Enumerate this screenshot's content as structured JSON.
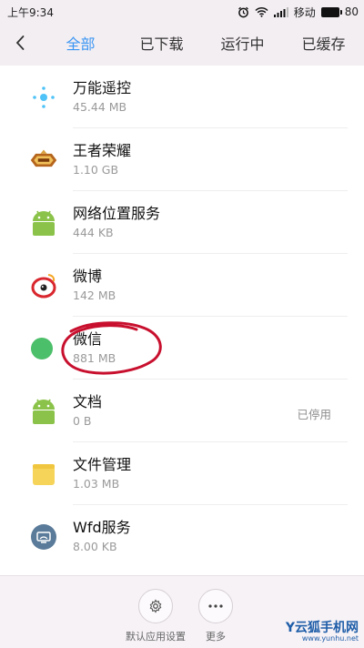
{
  "status_bar": {
    "time": "上午9:34",
    "carrier": "移动",
    "battery": "80"
  },
  "tabs": [
    {
      "label": "全部",
      "active": true
    },
    {
      "label": "已下载",
      "active": false
    },
    {
      "label": "运行中",
      "active": false
    },
    {
      "label": "已缓存",
      "active": false
    }
  ],
  "apps": [
    {
      "name": "万能遥控",
      "size": "45.44 MB",
      "status": "",
      "icon": "remote-control-icon"
    },
    {
      "name": "王者荣耀",
      "size": "1.10 GB",
      "status": "",
      "icon": "game-logo-icon"
    },
    {
      "name": "网络位置服务",
      "size": "444 KB",
      "status": "",
      "icon": "android-icon"
    },
    {
      "name": "微博",
      "size": "142 MB",
      "status": "",
      "icon": "weibo-icon"
    },
    {
      "name": "微信",
      "size": "881 MB",
      "status": "",
      "icon": "wechat-icon"
    },
    {
      "name": "文档",
      "size": "0 B",
      "status": "已停用",
      "icon": "android-icon"
    },
    {
      "name": "文件管理",
      "size": "1.03 MB",
      "status": "",
      "icon": "folder-icon"
    },
    {
      "name": "Wfd服务",
      "size": "8.00 KB",
      "status": "",
      "icon": "wfd-icon"
    }
  ],
  "bottom_bar": {
    "default_app_settings": "默认应用设置",
    "more": "更多"
  },
  "watermark": {
    "main": "Y云狐手机网",
    "sub": "www.yunhu.net"
  },
  "colors": {
    "accent": "#3b96f3",
    "android_green": "#8bc34a",
    "annotation_red": "#c8102e"
  }
}
